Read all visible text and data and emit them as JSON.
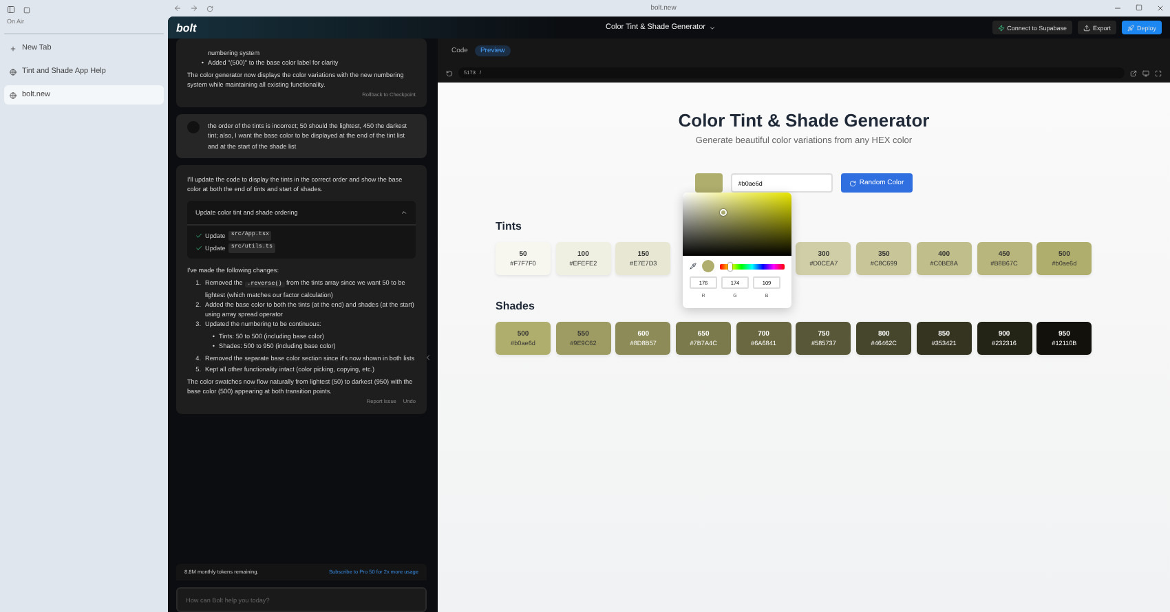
{
  "browser": {
    "sidebar_label": "On Air",
    "tabs": [
      {
        "label": "New Tab",
        "kind": "new",
        "selected": false
      },
      {
        "label": "Tint and Shade App Help",
        "kind": "page",
        "selected": false
      },
      {
        "label": "bolt.new",
        "kind": "page",
        "selected": true
      }
    ],
    "url": "bolt.new"
  },
  "app": {
    "logo": "bolt",
    "project_title": "Color Tint & Shade Generator",
    "buttons": [
      {
        "label": "Connect to Supabase",
        "kind": "supabase"
      },
      {
        "label": "Export",
        "kind": "export"
      },
      {
        "label": "Deploy",
        "kind": "deploy"
      }
    ]
  },
  "chat": {
    "messages": [
      {
        "kind": "assistant",
        "bullets": [
          {
            "text": "numbering system"
          },
          {
            "marker": "•",
            "text": "Added \"(500)\" to the base color label for clarity"
          }
        ],
        "paragraphs": [
          "The color generator now displays the color variations with the new numbering system while maintaining all existing functionality."
        ],
        "footer": [
          "Rollback to Checkpoint"
        ]
      },
      {
        "kind": "user",
        "text": "the order of the tints is incorrect; 50 should the lightest, 450 the darkest tint; also, I want the base color to be displayed at the end of the tint list and at the start of the shade list"
      },
      {
        "kind": "assistant",
        "paragraphs": [
          "I'll update the code to display the tints in the correct order and show the base color at both the end of tints and start of shades."
        ],
        "artifact": {
          "title": "Update color tint and shade ordering",
          "expanded": true,
          "actions": [
            {
              "label": "Update",
              "file": "src/App.tsx",
              "done": true
            },
            {
              "label": "Update",
              "file": "src/utils.ts",
              "done": true
            }
          ]
        },
        "intro": "I've made the following changes:",
        "list": [
          {
            "marker": "1.",
            "text": "Removed the",
            "code": ".reverse()",
            "rest": "from the tints array since we want 50 to be lightest (which matches our factor calculation)"
          },
          {
            "marker": "2.",
            "text": "Added the base color to both the tints (at the end) and shades (at the start) using array spread operator"
          },
          {
            "marker": "3.",
            "text": "Updated the numbering to be continuous:",
            "sub": [
              {
                "marker": "•",
                "text": "Tints: 50 to 500 (including base color)"
              },
              {
                "marker": "•",
                "text": "Shades: 500 to 950 (including base color)"
              }
            ]
          },
          {
            "marker": "4.",
            "text": "Removed the separate base color section since it's now shown in both lists"
          },
          {
            "marker": "5.",
            "text": "Kept all other functionality intact (color picking, copying, etc.)"
          }
        ],
        "closing": "The color swatches now flow naturally from lightest (50) to darkest (950) with the base color (500) appearing at both transition points.",
        "footer": [
          "Report Issue",
          "Undo"
        ]
      }
    ],
    "tokens": "8.8M monthly tokens remaining.",
    "subscribe": "Subscribe to Pro 50 for 2x more usage",
    "input": {
      "placeholder": "How can Bolt help you today?"
    }
  },
  "workbench": {
    "tabs": [
      {
        "label": "Code",
        "selected": false
      },
      {
        "label": "Preview",
        "selected": true
      }
    ],
    "port": "5173",
    "path": "/"
  },
  "preview": {
    "title": "Color Tint & Shade Generator",
    "subtitle": "Generate beautiful color variations from any HEX color",
    "hex_input": "#b0ae6d",
    "base_swatch": {
      "color": "#b0ae6d"
    },
    "random_button": "Random Color",
    "picker": {
      "hue": {
        "level": 0.17
      },
      "rgb": [
        {
          "value": "176",
          "label": "R"
        },
        {
          "value": "174",
          "label": "G"
        },
        {
          "value": "109",
          "label": "B"
        }
      ]
    },
    "tints_title": "Tints",
    "tints": [
      {
        "name": "50",
        "hex": "#F7F7F0",
        "color": "#f7f7f0"
      },
      {
        "name": "100",
        "hex": "#EFEFE2",
        "color": "#efefe2"
      },
      {
        "name": "150",
        "hex": "#E7E7D3",
        "color": "#e7e7d3"
      },
      {
        "name": "300",
        "hex": "#D0CEA7",
        "color": "#d0cea7"
      },
      {
        "name": "350",
        "hex": "#C8C699",
        "color": "#c8c699"
      },
      {
        "name": "400",
        "hex": "#C0BE8A",
        "color": "#c0be8a"
      },
      {
        "name": "450",
        "hex": "#B8B67C",
        "color": "#b8b67c"
      },
      {
        "name": "500",
        "hex": "#b0ae6d",
        "color": "#b0ae6d"
      }
    ],
    "shades_title": "Shades",
    "shades": [
      {
        "name": "500",
        "hex": "#b0ae6d",
        "color": "#b0ae6d"
      },
      {
        "name": "550",
        "hex": "#9E9C62",
        "color": "#9e9c62"
      },
      {
        "name": "600",
        "hex": "#8D8B57",
        "color": "#8d8b57"
      },
      {
        "name": "650",
        "hex": "#7B7A4C",
        "color": "#7b7a4c"
      },
      {
        "name": "700",
        "hex": "#6A6841",
        "color": "#6a6841"
      },
      {
        "name": "750",
        "hex": "#585737",
        "color": "#585737"
      },
      {
        "name": "800",
        "hex": "#46462C",
        "color": "#46462c"
      },
      {
        "name": "850",
        "hex": "#353421",
        "color": "#353421"
      },
      {
        "name": "900",
        "hex": "#232316",
        "color": "#232316"
      },
      {
        "name": "950",
        "hex": "#12110B",
        "color": "#12110b"
      }
    ]
  }
}
